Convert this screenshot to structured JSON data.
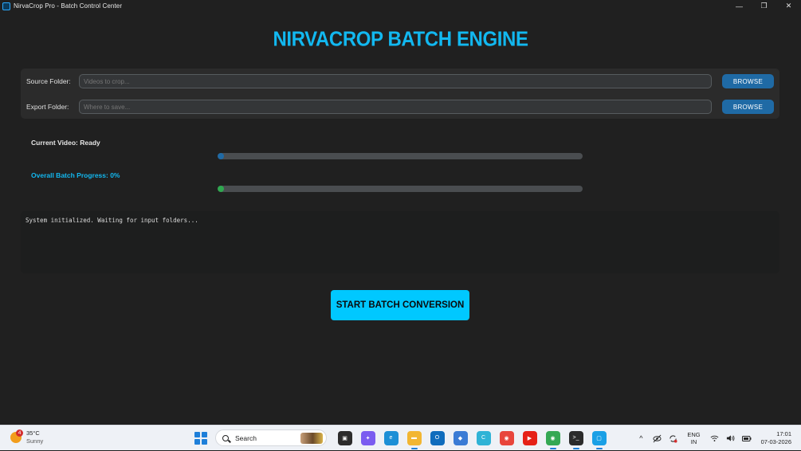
{
  "window": {
    "title": "NirvaCrop Pro - Batch Control Center",
    "controls": {
      "minimize": "—",
      "restore": "❐",
      "close": "✕"
    }
  },
  "heading": "NIRVACROP BATCH ENGINE",
  "source": {
    "label": "Source Folder:",
    "placeholder": "Videos to crop...",
    "value": "",
    "button": "BROWSE"
  },
  "export": {
    "label": "Export Folder:",
    "placeholder": "Where to save...",
    "value": "",
    "button": "BROWSE"
  },
  "progress": {
    "current_label": "Current Video: Ready",
    "current_fraction": 0.0,
    "overall_label": "Overall Batch Progress: 0%",
    "overall_fraction": 0.0
  },
  "colors": {
    "accent": "#12b8f0",
    "current_bar": "#1f6aa5",
    "overall_bar": "#2fa84f",
    "start_button": "#00c8ff",
    "browse_button": "#1f6aa5"
  },
  "log": "System initialized. Waiting for input folders...",
  "start_button": "START BATCH CONVERSION",
  "taskbar": {
    "weather": {
      "temp": "35°C",
      "condition": "Sunny",
      "badge": "4"
    },
    "search_label": "Search",
    "apps": [
      {
        "name": "task-view-icon",
        "color": "#2c2c2c",
        "glyph": "▣",
        "active": false
      },
      {
        "name": "copilot-icon",
        "color": "#7a5cf0",
        "glyph": "✦",
        "active": false
      },
      {
        "name": "edge-icon",
        "color": "#1c8fd6",
        "glyph": "e",
        "active": false
      },
      {
        "name": "file-explorer-icon",
        "color": "#f2b632",
        "glyph": "▬",
        "active": true
      },
      {
        "name": "outlook-icon",
        "color": "#0f6cbd",
        "glyph": "O",
        "active": false
      },
      {
        "name": "store-icon",
        "color": "#3a7bd5",
        "glyph": "◆",
        "active": false
      },
      {
        "name": "canva-icon",
        "color": "#2fb3d6",
        "glyph": "C",
        "active": false
      },
      {
        "name": "chrome-icon",
        "color": "#e8453c",
        "glyph": "◉",
        "active": false
      },
      {
        "name": "youtube-icon",
        "color": "#e62117",
        "glyph": "▶",
        "active": false
      },
      {
        "name": "chrome-profile-icon",
        "color": "#34a853",
        "glyph": "◉",
        "active": true
      },
      {
        "name": "terminal-icon",
        "color": "#2b2b2b",
        "glyph": ">_",
        "active": true
      },
      {
        "name": "nirvacrop-icon",
        "color": "#1aa0e6",
        "glyph": "▢",
        "active": true
      }
    ],
    "tray": {
      "chevron": "^",
      "lang_top": "ENG",
      "lang_bottom": "IN",
      "time": "17:01",
      "date": "07-03-2026"
    }
  }
}
